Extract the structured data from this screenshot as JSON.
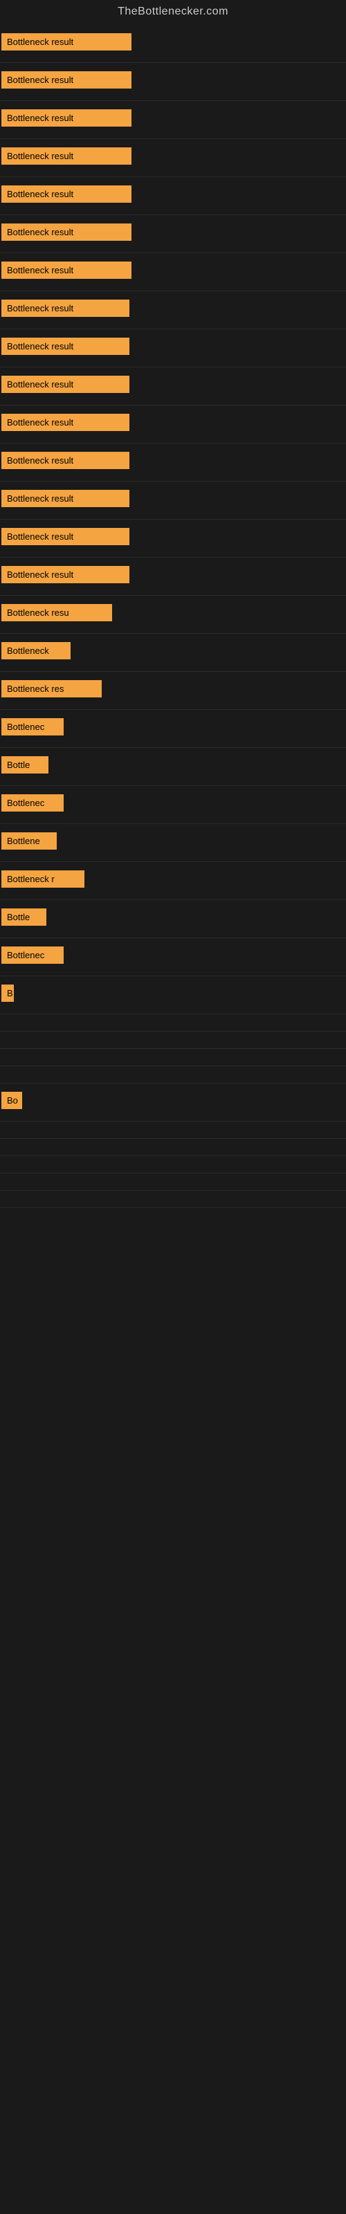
{
  "site": {
    "title": "TheBottlenecker.com"
  },
  "rows": [
    {
      "label": "Bottleneck result",
      "width": 188
    },
    {
      "label": "Bottleneck result",
      "width": 188
    },
    {
      "label": "Bottleneck result",
      "width": 188
    },
    {
      "label": "Bottleneck result",
      "width": 188
    },
    {
      "label": "Bottleneck result",
      "width": 188
    },
    {
      "label": "Bottleneck result",
      "width": 188
    },
    {
      "label": "Bottleneck result",
      "width": 188
    },
    {
      "label": "Bottleneck result",
      "width": 185
    },
    {
      "label": "Bottleneck result",
      "width": 185
    },
    {
      "label": "Bottleneck result",
      "width": 185
    },
    {
      "label": "Bottleneck result",
      "width": 185
    },
    {
      "label": "Bottleneck result",
      "width": 185
    },
    {
      "label": "Bottleneck result",
      "width": 185
    },
    {
      "label": "Bottleneck result",
      "width": 185
    },
    {
      "label": "Bottleneck result",
      "width": 185
    },
    {
      "label": "Bottleneck resu",
      "width": 160
    },
    {
      "label": "Bottleneck",
      "width": 100
    },
    {
      "label": "Bottleneck res",
      "width": 145
    },
    {
      "label": "Bottlenec",
      "width": 90
    },
    {
      "label": "Bottle",
      "width": 68
    },
    {
      "label": "Bottlenec",
      "width": 90
    },
    {
      "label": "Bottlene",
      "width": 80
    },
    {
      "label": "Bottleneck r",
      "width": 120
    },
    {
      "label": "Bottle",
      "width": 65
    },
    {
      "label": "Bottlenec",
      "width": 90
    },
    {
      "label": "B",
      "width": 18
    },
    {
      "label": "",
      "width": 0
    },
    {
      "label": "",
      "width": 0
    },
    {
      "label": "",
      "width": 0
    },
    {
      "label": "",
      "width": 0
    },
    {
      "label": "Bo",
      "width": 30
    },
    {
      "label": "",
      "width": 0
    },
    {
      "label": "",
      "width": 0
    },
    {
      "label": "",
      "width": 0
    },
    {
      "label": "",
      "width": 0
    },
    {
      "label": "",
      "width": 0
    }
  ]
}
